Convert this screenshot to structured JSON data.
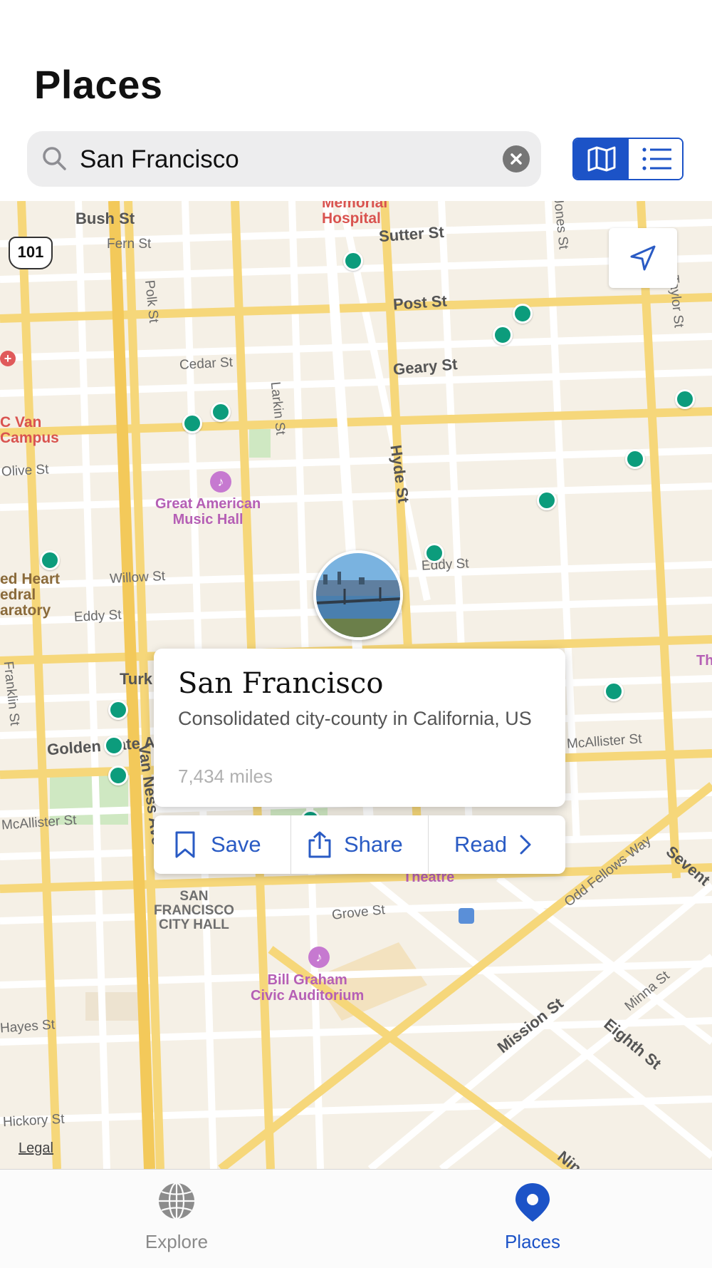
{
  "header": {
    "title": "Places",
    "search": {
      "value": "San Francisco",
      "placeholder": ""
    }
  },
  "map": {
    "streets": [
      "Bush St",
      "Fern St",
      "Sutter St",
      "Post St",
      "Cedar St",
      "Geary St",
      "Polk St",
      "Larkin St",
      "Hyde St",
      "Jones St",
      "Taylor St",
      "Olive St",
      "Willow St",
      "Eddy St",
      "Turk",
      "Golden Gate A",
      "McAllister St",
      "Van Ness Ave",
      "Grove St",
      "Hayes St",
      "Hickory St",
      "Mission St",
      "Eighth St",
      "Minna St",
      "Odd Fellows Way",
      "Sevent",
      "Franklin St",
      "Nin"
    ],
    "places": {
      "hospital": "Memorial\nHospital",
      "music_hall": "Great American\nMusic Hall",
      "auditorium": "Bill Graham\nCivic Auditorium",
      "city_hall": "SAN\nFRANCISCO\nCITY HALL",
      "campus": "C Van\nCampus",
      "cathedral": "ed Heart\nedral\naratory",
      "theatre": "Theatre",
      "th": "Th"
    },
    "highway_shield": "101",
    "legal": "Legal"
  },
  "info_card": {
    "name": "San Francisco",
    "description": "Consolidated city-county in California, US",
    "distance": "7,434 miles"
  },
  "actions": {
    "save": "Save",
    "share": "Share",
    "read": "Read"
  },
  "tabs": {
    "explore": "Explore",
    "places": "Places"
  },
  "colors": {
    "accent": "#1c53c7",
    "pin": "#0c9c7c",
    "map_bg": "#f5f0e6",
    "road": "#f6d77a"
  }
}
